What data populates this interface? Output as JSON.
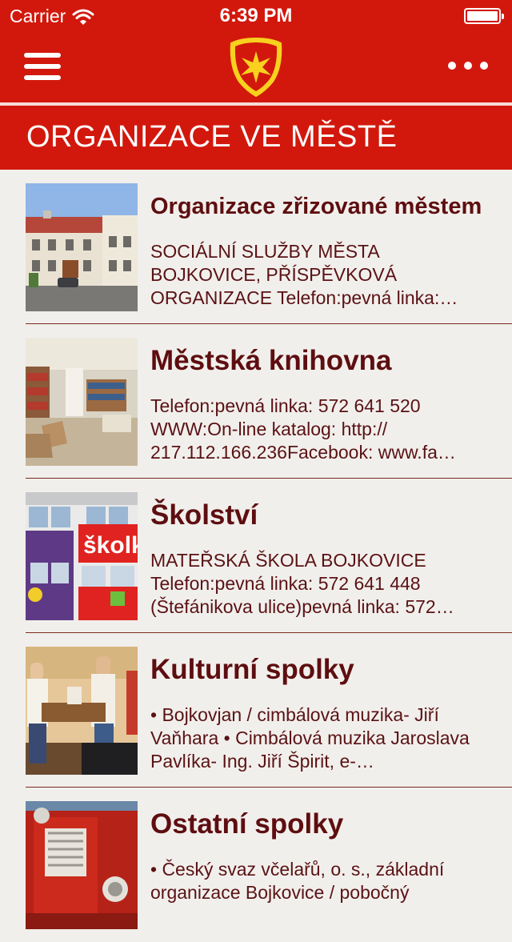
{
  "status": {
    "carrier": "Carrier",
    "time": "6:39 PM"
  },
  "header": {
    "title": "ORGANIZACE VE MĚSTĚ"
  },
  "items": [
    {
      "title": "Organizace zřizované městem",
      "desc": "SOCIÁLNÍ SLUŽBY MĚSTA BOJKOVICE, PŘÍSPĚVKOVÁ ORGANIZACE  Telefon:pevná linka:…"
    },
    {
      "title": "Městská knihovna",
      "desc": "Telefon:pevná linka: 572 641 520 WWW:On-line katalog: http:// 217.112.166.236Facebook: www.fa…"
    },
    {
      "title": "Školství",
      "desc": "MATEŘSKÁ ŠKOLA BOJKOVICE Telefon:pevná linka: 572 641 448 (Štefánikova ulice)pevná linka: 572…"
    },
    {
      "title": "Kulturní spolky",
      "desc": "• Bojkovjan / cimbálová muzika- Jiří Vaňhara  • Cimbálová muzika Jaroslava Pavlíka- Ing. Jiří Špirit, e-…"
    },
    {
      "title": "Ostatní spolky",
      "desc": "• Český svaz včelařů, o. s., základní organizace Bojkovice / pobočný"
    }
  ],
  "thumb_text": {
    "skolka": "školk"
  },
  "colors": {
    "brand_red": "#d2180c",
    "title_text": "#5e0e10",
    "background": "#f1efec"
  }
}
